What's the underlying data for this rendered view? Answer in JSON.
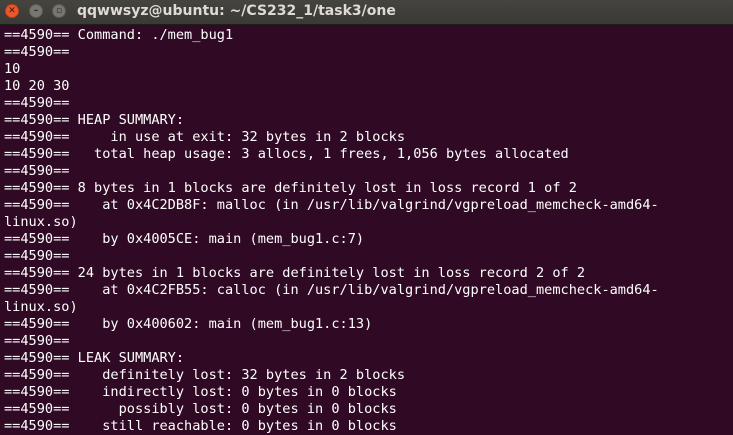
{
  "window": {
    "title": "qqwwsyz@ubuntu: ~/CS232_1/task3/one",
    "close_glyph": "✕",
    "minimize_glyph": "–",
    "maximize_glyph": "▫"
  },
  "colors": {
    "terminal_background": "#300a24",
    "terminal_text": "#ffffff",
    "titlebar": "#3c3b37",
    "close_button": "#e9592b"
  },
  "terminal": {
    "lines": [
      "==4590== Command: ./mem_bug1",
      "==4590==",
      "10",
      "10 20 30",
      "==4590==",
      "==4590== HEAP SUMMARY:",
      "==4590==     in use at exit: 32 bytes in 2 blocks",
      "==4590==   total heap usage: 3 allocs, 1 frees, 1,056 bytes allocated",
      "==4590==",
      "==4590== 8 bytes in 1 blocks are definitely lost in loss record 1 of 2",
      "==4590==    at 0x4C2DB8F: malloc (in /usr/lib/valgrind/vgpreload_memcheck-amd64-",
      "linux.so)",
      "==4590==    by 0x4005CE: main (mem_bug1.c:7)",
      "==4590==",
      "==4590== 24 bytes in 1 blocks are definitely lost in loss record 2 of 2",
      "==4590==    at 0x4C2FB55: calloc (in /usr/lib/valgrind/vgpreload_memcheck-amd64-",
      "linux.so)",
      "==4590==    by 0x400602: main (mem_bug1.c:13)",
      "==4590==",
      "==4590== LEAK SUMMARY:",
      "==4590==    definitely lost: 32 bytes in 2 blocks",
      "==4590==    indirectly lost: 0 bytes in 0 blocks",
      "==4590==      possibly lost: 0 bytes in 0 blocks",
      "==4590==    still reachable: 0 bytes in 0 blocks"
    ]
  }
}
